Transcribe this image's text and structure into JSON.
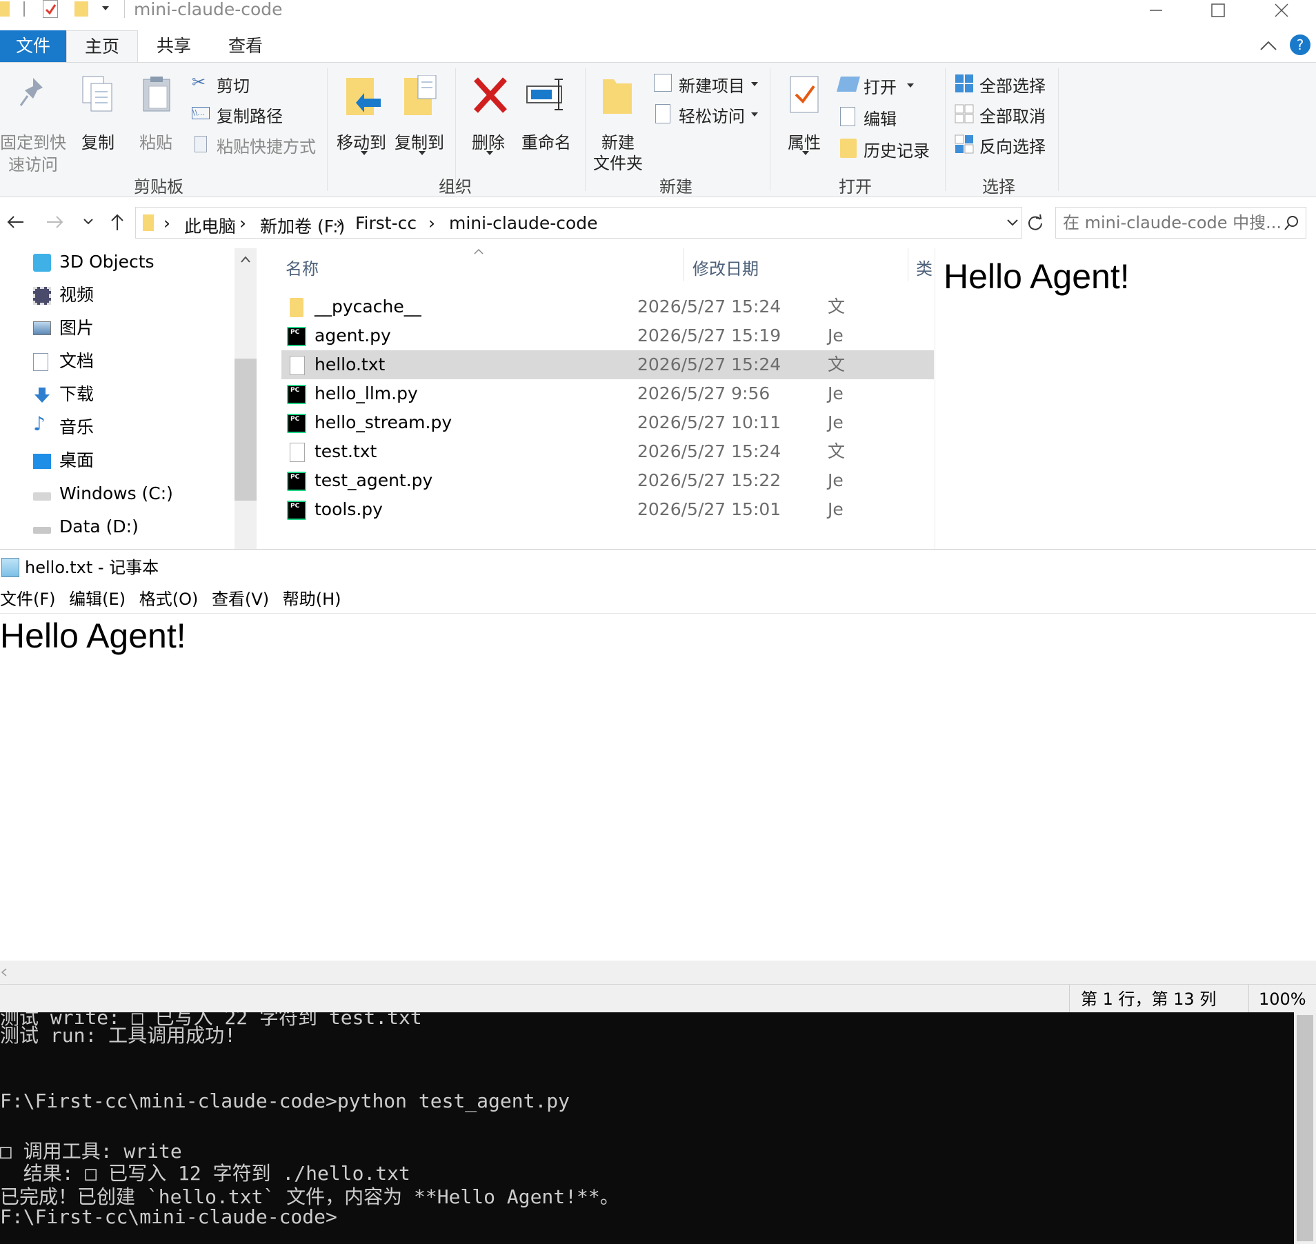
{
  "explorer": {
    "title": "mini-claude-code",
    "ribbon_tabs": [
      "文件",
      "主页",
      "共享",
      "查看"
    ],
    "ribbon": {
      "pin_label_1": "固定到快",
      "pin_label_2": "速访问",
      "copy": "复制",
      "paste": "粘贴",
      "cut": "剪切",
      "copy_path": "复制路径",
      "paste_shortcut": "粘贴快捷方式",
      "clipboard_group": "剪贴板",
      "move_to": "移动到",
      "copy_to": "复制到",
      "delete": "删除",
      "rename": "重命名",
      "organize_group": "组织",
      "new_folder_1": "新建",
      "new_folder_2": "文件夹",
      "new_item": "新建项目",
      "easy_access": "轻松访问",
      "new_group": "新建",
      "properties": "属性",
      "open": "打开",
      "edit": "编辑",
      "history": "历史记录",
      "open_group": "打开",
      "select_all": "全部选择",
      "select_none": "全部取消",
      "invert_selection": "反向选择",
      "select_group": "选择"
    },
    "breadcrumb": [
      "此电脑",
      "新加卷 (F:)",
      "First-cc",
      "mini-claude-code"
    ],
    "search_placeholder": "在 mini-claude-code 中搜...",
    "nav_items": [
      {
        "label": "3D Objects",
        "icon": "3d-objects-icon"
      },
      {
        "label": "视频",
        "icon": "video-icon"
      },
      {
        "label": "图片",
        "icon": "pictures-icon"
      },
      {
        "label": "文档",
        "icon": "documents-icon"
      },
      {
        "label": "下载",
        "icon": "downloads-icon"
      },
      {
        "label": "音乐",
        "icon": "music-icon"
      },
      {
        "label": "桌面",
        "icon": "desktop-icon"
      },
      {
        "label": "Windows (C:)",
        "icon": "drive-c-icon"
      },
      {
        "label": "Data (D:)",
        "icon": "drive-d-icon"
      }
    ],
    "columns": {
      "name": "名称",
      "modified": "修改日期",
      "type": "类"
    },
    "files": [
      {
        "name": "__pycache__",
        "date": "2026/5/27 15:24",
        "type": "文",
        "icon": "folder"
      },
      {
        "name": "agent.py",
        "date": "2026/5/27 15:19",
        "type": "Je",
        "icon": "python"
      },
      {
        "name": "hello.txt",
        "date": "2026/5/27 15:24",
        "type": "文",
        "icon": "text",
        "selected": true
      },
      {
        "name": "hello_llm.py",
        "date": "2026/5/27 9:56",
        "type": "Je",
        "icon": "python"
      },
      {
        "name": "hello_stream.py",
        "date": "2026/5/27 10:11",
        "type": "Je",
        "icon": "python"
      },
      {
        "name": "test.txt",
        "date": "2026/5/27 15:24",
        "type": "文",
        "icon": "text"
      },
      {
        "name": "test_agent.py",
        "date": "2026/5/27 15:22",
        "type": "Je",
        "icon": "python"
      },
      {
        "name": "tools.py",
        "date": "2026/5/27 15:01",
        "type": "Je",
        "icon": "python"
      }
    ],
    "preview_text": "Hello Agent!"
  },
  "notepad": {
    "title": "hello.txt - 记事本",
    "menu": [
      "文件(F)",
      "编辑(E)",
      "格式(O)",
      "查看(V)",
      "帮助(H)"
    ],
    "content": "Hello Agent!",
    "status_position": "第 1 行，第 13 列",
    "status_zoom": "100%"
  },
  "console": {
    "lines": [
      "测试 write: □ 已写入 22 字符到 test.txt",
      "测试 run: 工具调用成功!",
      "",
      "",
      "F:\\First-cc\\mini-claude-code>python test_agent.py",
      "",
      "□ 调用工具: write",
      "  结果: □ 已写入 12 字符到 ./hello.txt",
      "已完成！已创建 `hello.txt` 文件，内容为 **Hello Agent!**。",
      "F:\\First-cc\\mini-claude-code>"
    ]
  },
  "colors": {
    "file_tab": "#1979ca",
    "ribbon_bg": "#f5f6f7",
    "selected_row": "#d9d9d9",
    "console_bg": "#0c0c0c",
    "console_text": "#cccccc",
    "pycharm_green": "#21d789"
  }
}
